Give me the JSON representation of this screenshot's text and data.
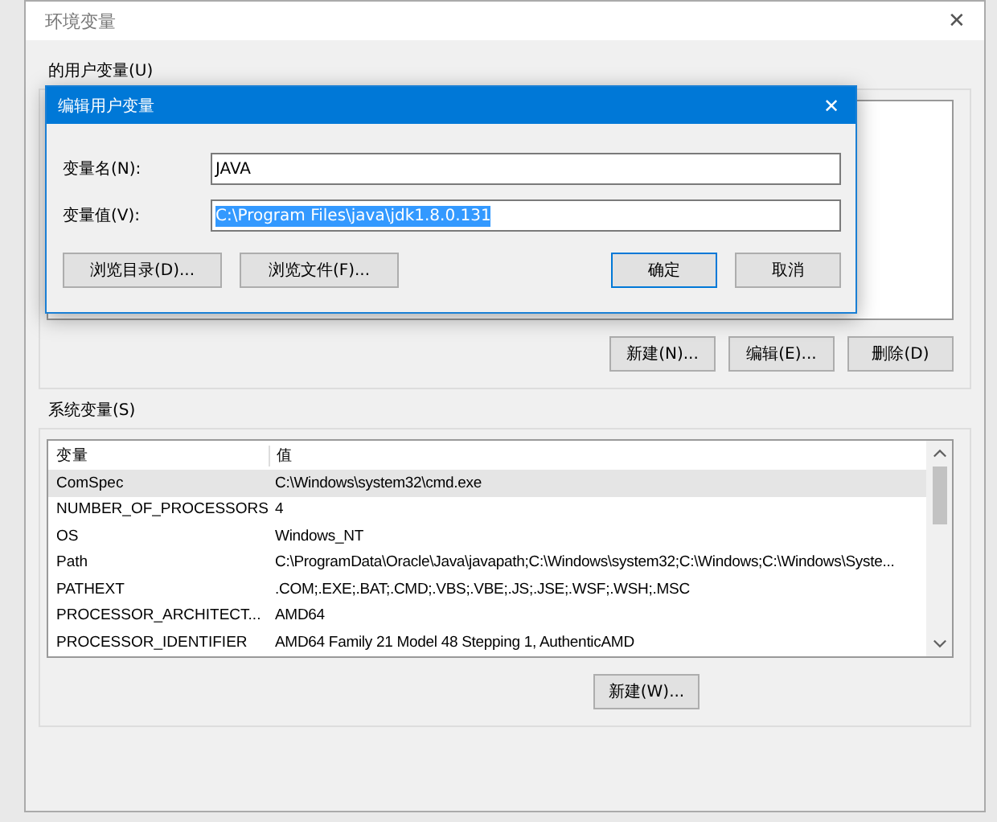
{
  "window": {
    "title": "环境变量",
    "close": "✕"
  },
  "user_vars": {
    "label": "的用户变量(U)",
    "buttons": [
      "新建(N)...",
      "编辑(E)...",
      "删除(D)"
    ]
  },
  "system_vars": {
    "label": "系统变量(S)",
    "columns": [
      "变量",
      "值"
    ],
    "rows": [
      {
        "name": "ComSpec",
        "value": "C:\\Windows\\system32\\cmd.exe",
        "selected": true
      },
      {
        "name": "NUMBER_OF_PROCESSORS",
        "value": "4",
        "selected": false
      },
      {
        "name": "OS",
        "value": "Windows_NT",
        "selected": false
      },
      {
        "name": "Path",
        "value": "C:\\ProgramData\\Oracle\\Java\\javapath;C:\\Windows\\system32;C:\\Windows;C:\\Windows\\Syste...",
        "selected": false
      },
      {
        "name": "PATHEXT",
        "value": ".COM;.EXE;.BAT;.CMD;.VBS;.VBE;.JS;.JSE;.WSF;.WSH;.MSC",
        "selected": false
      },
      {
        "name": "PROCESSOR_ARCHITECT...",
        "value": "AMD64",
        "selected": false
      },
      {
        "name": "PROCESSOR_IDENTIFIER",
        "value": "AMD64 Family 21 Model 48 Stepping 1, AuthenticAMD",
        "selected": false
      }
    ],
    "buttons": [
      "新建(W)..."
    ]
  },
  "dialog": {
    "title": "编辑用户变量",
    "close": "✕",
    "fields": [
      {
        "label": "变量名(N):",
        "value": "JAVA",
        "selected": false
      },
      {
        "label": "变量值(V):",
        "value": "C:\\Program Files\\java\\jdk1.8.0.131",
        "selected": true
      }
    ],
    "browse_buttons": [
      "浏览目录(D)...",
      "浏览文件(F)..."
    ],
    "ok": "确定",
    "cancel": "取消"
  }
}
